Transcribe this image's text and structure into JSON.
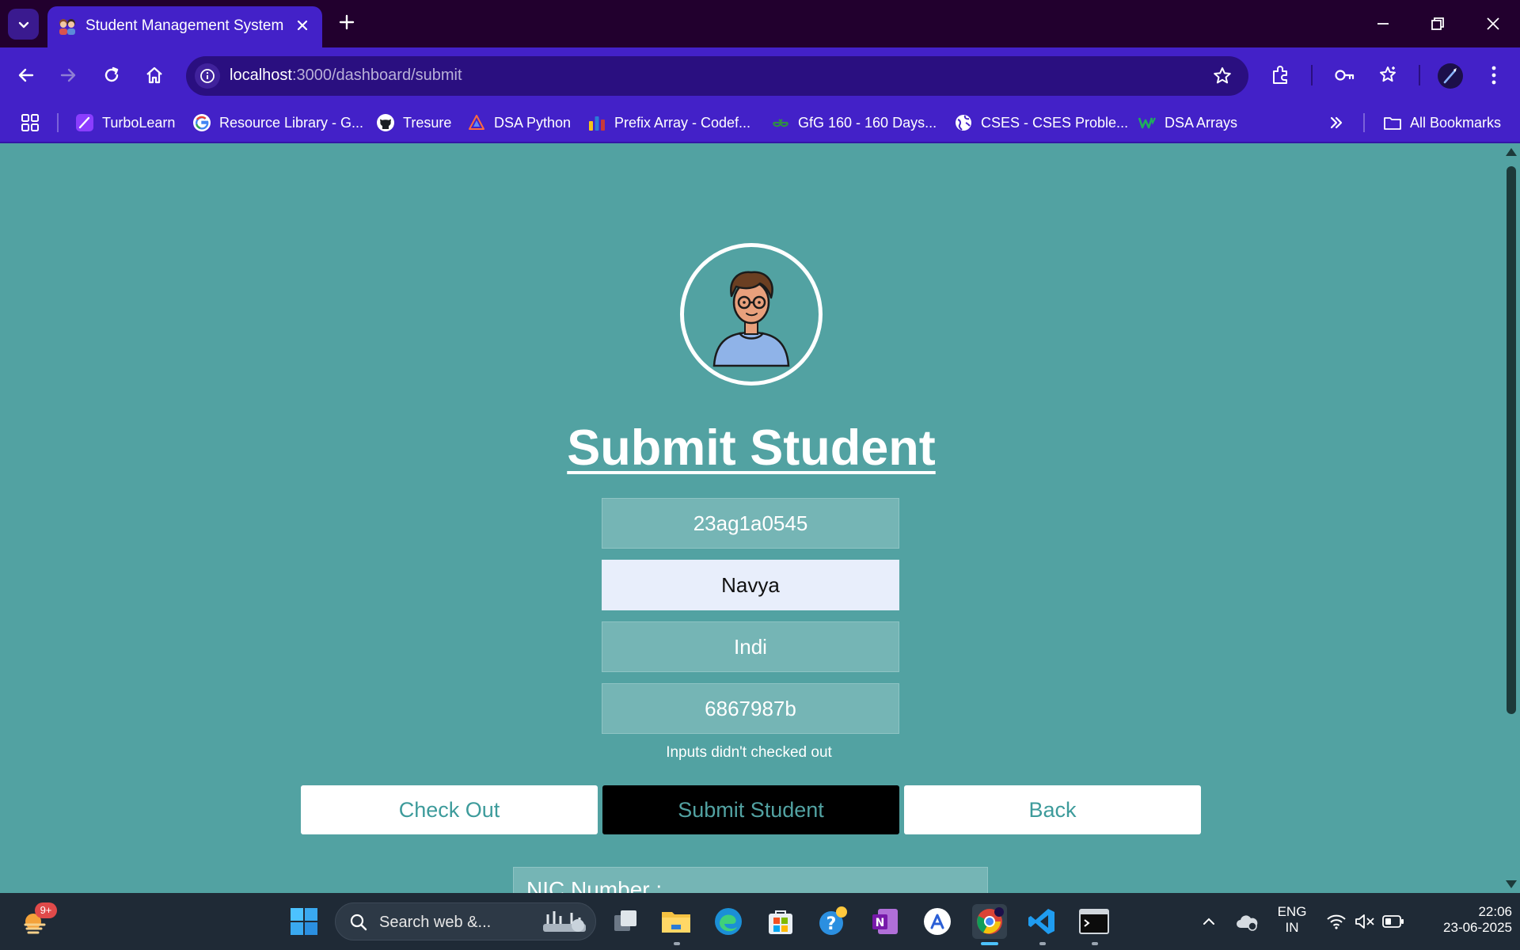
{
  "browser": {
    "tab_title": "Student Management System",
    "url_host": "localhost",
    "url_path": ":3000/dashboard/submit",
    "bookmarks": [
      {
        "label": "TurboLearn"
      },
      {
        "label": "Resource Library - G..."
      },
      {
        "label": "Tresure"
      },
      {
        "label": "DSA Python"
      },
      {
        "label": "Prefix Array - Codef..."
      },
      {
        "label": "GfG 160 - 160 Days..."
      },
      {
        "label": "CSES - CSES Proble..."
      },
      {
        "label": "DSA Arrays"
      }
    ],
    "all_bookmarks_label": "All Bookmarks"
  },
  "page": {
    "title": "Submit Student",
    "fields": [
      {
        "value": "23ag1a0545"
      },
      {
        "value": "Navya"
      },
      {
        "value": "Indi"
      },
      {
        "value": "6867987b"
      }
    ],
    "status_message": "Inputs didn't checked out",
    "buttons": {
      "check_out": "Check Out",
      "submit": "Submit Student",
      "back": "Back"
    },
    "nic_label": "NIC Number :"
  },
  "taskbar": {
    "search_text": "Search web &...",
    "notification_badge": "9+",
    "language_line1": "ENG",
    "language_line2": "IN",
    "time": "22:06",
    "date": "23-06-2025"
  },
  "colors": {
    "page_background": "#52a2a2",
    "browser_accent": "#4321c8",
    "field_background": "#75b5b5",
    "button_text": "#3d9b9b"
  }
}
